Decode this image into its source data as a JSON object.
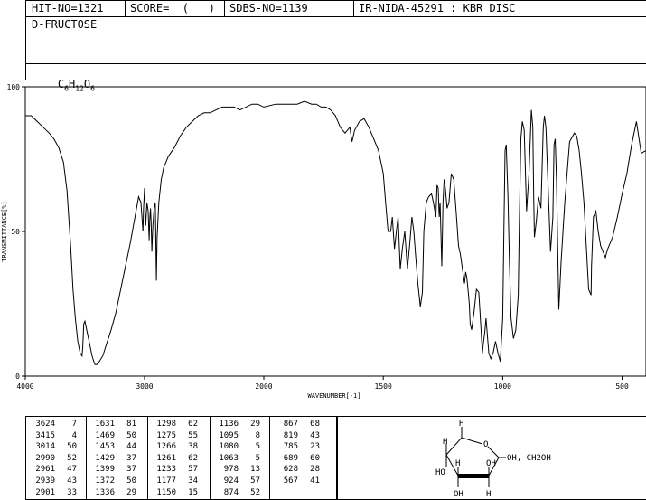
{
  "header": {
    "hit_no": "HIT-NO=1321",
    "score": "SCORE=  (   )",
    "sdbs_no": "SDBS-NO=1139",
    "ir_nida": "IR-NIDA-45291 : KBR DISC",
    "compound": "D-FRUCTOSE",
    "formula": {
      "C": "C",
      "c_sub": "6",
      "H": "H",
      "h_sub": "12",
      "O": "O",
      "o_sub": "6"
    }
  },
  "chart_data": {
    "type": "line",
    "title": "",
    "xlabel": "WAVENUMBER[-1]",
    "ylabel": "TRANSMITTANCE[%]",
    "xlim": [
      4000,
      400
    ],
    "ylim": [
      0,
      100
    ],
    "x_ticks": [
      4000,
      3000,
      2000,
      1500,
      1000,
      500
    ],
    "y_ticks": [
      0,
      50,
      100
    ],
    "grid": false,
    "series": [
      {
        "x": [
          4000,
          3950,
          3900,
          3850,
          3800,
          3760,
          3720,
          3680,
          3650,
          3620,
          3600,
          3580,
          3560,
          3540,
          3524,
          3518,
          3510,
          3500,
          3480,
          3460,
          3440,
          3425,
          3415,
          3400,
          3380,
          3350,
          3320,
          3280,
          3240,
          3200,
          3160,
          3120,
          3080,
          3050,
          3030,
          3014,
          3008,
          3000,
          2995,
          2990,
          2980,
          2970,
          2961,
          2955,
          2950,
          2945,
          2939,
          2930,
          2920,
          2910,
          2901,
          2895,
          2880,
          2860,
          2840,
          2800,
          2750,
          2700,
          2650,
          2600,
          2550,
          2500,
          2450,
          2400,
          2350,
          2300,
          2250,
          2200,
          2150,
          2100,
          2050,
          2000,
          1950,
          1900,
          1860,
          1830,
          1800,
          1780,
          1760,
          1740,
          1720,
          1700,
          1680,
          1660,
          1640,
          1631,
          1620,
          1600,
          1580,
          1560,
          1540,
          1520,
          1500,
          1490,
          1480,
          1469,
          1462,
          1453,
          1445,
          1438,
          1429,
          1420,
          1410,
          1399,
          1390,
          1380,
          1372,
          1365,
          1355,
          1345,
          1336,
          1330,
          1320,
          1310,
          1298,
          1290,
          1280,
          1275,
          1270,
          1266,
          1262,
          1255,
          1250,
          1245,
          1240,
          1233,
          1225,
          1215,
          1205,
          1195,
          1185,
          1177,
          1170,
          1160,
          1155,
          1150,
          1145,
          1140,
          1136,
          1130,
          1120,
          1110,
          1100,
          1095,
          1090,
          1085,
          1080,
          1075,
          1070,
          1063,
          1058,
          1050,
          1040,
          1030,
          1020,
          1010,
          1000,
          995,
          990,
          985,
          978,
          972,
          965,
          955,
          945,
          935,
          930,
          924,
          918,
          910,
          900,
          890,
          880,
          874,
          870,
          867,
          860,
          850,
          840,
          830,
          825,
          819,
          812,
          800,
          790,
          785,
          780,
          775,
          765,
          755,
          740,
          720,
          700,
          690,
          680,
          670,
          660,
          650,
          640,
          630,
          628,
          620,
          610,
          600,
          590,
          580,
          570,
          567,
          560,
          540,
          520,
          500,
          480,
          460,
          440,
          420,
          400
        ],
        "values": [
          90,
          90,
          88,
          86,
          84,
          82,
          79,
          74,
          64,
          45,
          30,
          20,
          12,
          8,
          7,
          10,
          18,
          19,
          15,
          11,
          7,
          5,
          4,
          4,
          5,
          7,
          11,
          16,
          22,
          30,
          38,
          46,
          55,
          62,
          60,
          50,
          58,
          65,
          56,
          52,
          60,
          57,
          47,
          55,
          58,
          53,
          43,
          52,
          58,
          60,
          33,
          48,
          60,
          68,
          72,
          76,
          79,
          83,
          86,
          88,
          90,
          91,
          91,
          92,
          93,
          93,
          93,
          92,
          93,
          94,
          94,
          93,
          94,
          94,
          94,
          95,
          94,
          94,
          93,
          93,
          92,
          90,
          86,
          84,
          86,
          81,
          85,
          88,
          89,
          86,
          82,
          78,
          70,
          60,
          50,
          50,
          55,
          44,
          50,
          55,
          37,
          44,
          50,
          37,
          45,
          55,
          50,
          42,
          32,
          24,
          29,
          50,
          60,
          62,
          63,
          60,
          55,
          66,
          65,
          55,
          60,
          38,
          60,
          68,
          65,
          58,
          60,
          70,
          68,
          57,
          45,
          42,
          38,
          32,
          36,
          34,
          30,
          25,
          18,
          16,
          22,
          30,
          29,
          22,
          15,
          8,
          12,
          15,
          20,
          13,
          8,
          6,
          8,
          12,
          8,
          5,
          20,
          50,
          78,
          80,
          62,
          40,
          20,
          13,
          16,
          28,
          55,
          82,
          88,
          85,
          57,
          70,
          92,
          86,
          62,
          48,
          53,
          62,
          58,
          86,
          90,
          86,
          70,
          43,
          55,
          80,
          82,
          68,
          23,
          40,
          60,
          81,
          84,
          83,
          78,
          70,
          60,
          45,
          30,
          28,
          38,
          55,
          57,
          50,
          45,
          43,
          41,
          42,
          44,
          48,
          55,
          63,
          70,
          80,
          88,
          77,
          78
        ]
      }
    ]
  },
  "peak_table": {
    "columns": [
      [
        [
          "3624",
          "7"
        ],
        [
          "3415",
          "4"
        ],
        [
          "3014",
          "50"
        ],
        [
          "2990",
          "52"
        ],
        [
          "2961",
          "47"
        ],
        [
          "2939",
          "43"
        ],
        [
          "2901",
          "33"
        ]
      ],
      [
        [
          "1631",
          "81"
        ],
        [
          "1469",
          "50"
        ],
        [
          "1453",
          "44"
        ],
        [
          "1429",
          "37"
        ],
        [
          "1399",
          "37"
        ],
        [
          "1372",
          "50"
        ],
        [
          "1336",
          "29"
        ]
      ],
      [
        [
          "1298",
          "62"
        ],
        [
          "1275",
          "55"
        ],
        [
          "1266",
          "38"
        ],
        [
          "1261",
          "62"
        ],
        [
          "1233",
          "57"
        ],
        [
          "1177",
          "34"
        ],
        [
          "1150",
          "15"
        ]
      ],
      [
        [
          "1136",
          "29"
        ],
        [
          "1095",
          "8"
        ],
        [
          "1080",
          "5"
        ],
        [
          "1063",
          "5"
        ],
        [
          "978",
          "13"
        ],
        [
          "924",
          "57"
        ],
        [
          "874",
          "52"
        ]
      ],
      [
        [
          "867",
          "68"
        ],
        [
          "819",
          "43"
        ],
        [
          "785",
          "23"
        ],
        [
          "689",
          "60"
        ],
        [
          "628",
          "28"
        ],
        [
          "567",
          "41"
        ]
      ]
    ]
  },
  "structure": {
    "substituent": "OH, CH2OH",
    "labels": [
      "H",
      "O",
      "OH",
      "CH₂OH",
      "HO",
      "H",
      "OH",
      "H",
      "H",
      "OH",
      "H"
    ]
  }
}
